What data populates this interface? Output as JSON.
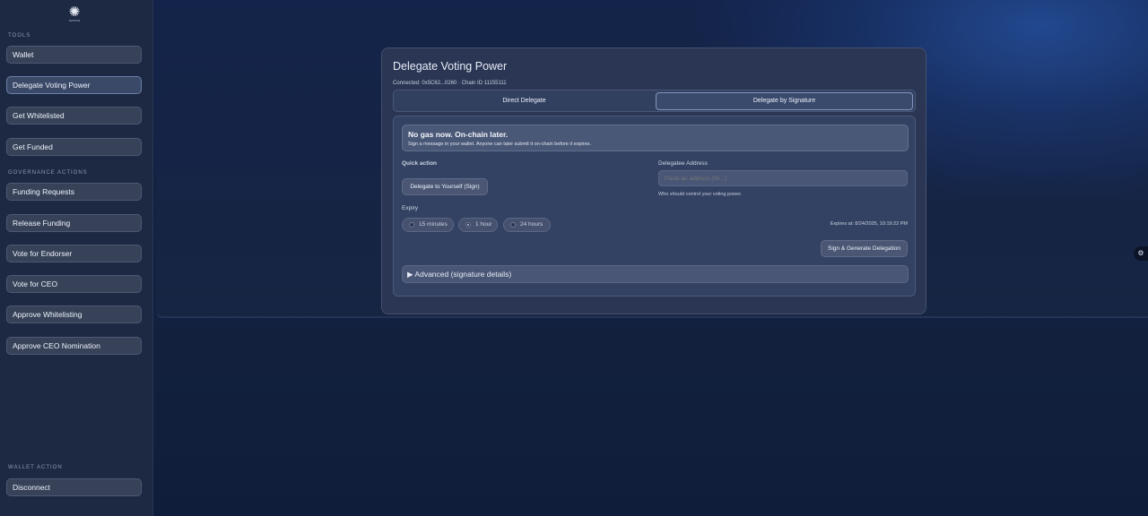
{
  "sidebar": {
    "logo": {
      "icon": "gear-logo-icon",
      "text": "NATION"
    },
    "tools_title": "TOOLS",
    "tools": [
      {
        "label": "Wallet"
      },
      {
        "label": "Delegate Voting Power"
      },
      {
        "label": "Get Whitelisted"
      },
      {
        "label": "Get Funded"
      }
    ],
    "governance_title": "GOVERNANCE ACTIONS",
    "governance": [
      {
        "label": "Funding Requests"
      },
      {
        "label": "Release Funding"
      },
      {
        "label": "Vote for Endorser"
      },
      {
        "label": "Vote for CEO"
      },
      {
        "label": "Approve Whitelisting"
      },
      {
        "label": "Approve CEO Nomination"
      }
    ],
    "wallet_title": "WALLET ACTION",
    "disconnect_label": "Disconnect"
  },
  "card": {
    "title": "Delegate Voting Power",
    "connection": "Connected: 0x5C62...0260 · Chain ID 11155111",
    "tabs": [
      {
        "label": "Direct Delegate"
      },
      {
        "label": "Delegate by Signature"
      }
    ],
    "active_tab": "Delegate by Signature",
    "banner": {
      "title": "No gas now. On-chain later.",
      "subtitle": "Sign a message in your wallet. Anyone can later submit it on-chain before it expires."
    },
    "quick_action_label": "Quick action",
    "quick_action_button": "Delegate to Yourself (Sign)",
    "delegatee_label": "Delegatee Address",
    "delegatee_placeholder": "Paste an address (0x...)",
    "delegatee_help": "Who should control your voting power.",
    "expiry_label": "Expiry",
    "expiry_options": [
      {
        "label": "15 minutes",
        "checked": false
      },
      {
        "label": "1 hour",
        "checked": true
      },
      {
        "label": "24 hours",
        "checked": false
      }
    ],
    "expires_at": "Expires at: 8/24/2025, 10:19:22 PM",
    "sign_button": "Sign & Generate Delegation",
    "advanced_label": "▶ Advanced (signature details)"
  },
  "edge_widget": {
    "icon": "floating-menu-icon",
    "glyph": "⚙︎"
  },
  "colors": {
    "accent_border": "#8095c2",
    "background": "#12213f"
  }
}
